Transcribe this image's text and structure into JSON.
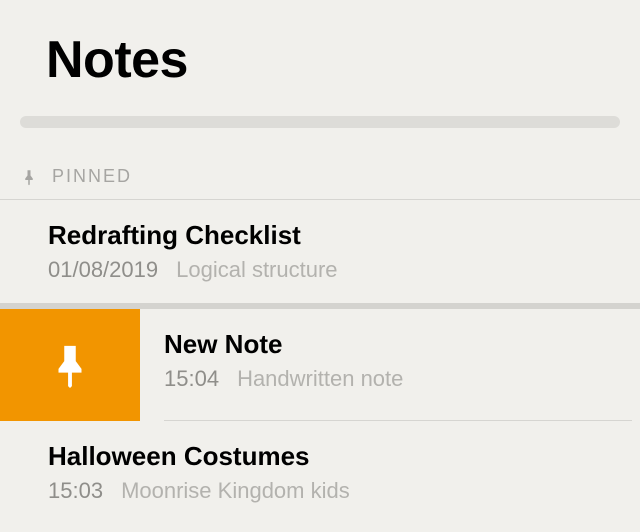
{
  "header": {
    "title": "Notes"
  },
  "pinned_section": {
    "label": "PINNED"
  },
  "pinned_notes": [
    {
      "title": "Redrafting Checklist",
      "date": "01/08/2019",
      "preview": "Logical structure"
    }
  ],
  "notes": [
    {
      "title": "New Note",
      "time": "15:04",
      "preview": "Handwritten note",
      "swiped": true
    },
    {
      "title": "Halloween Costumes",
      "time": "15:03",
      "preview": "Moonrise Kingdom kids",
      "swiped": false
    }
  ],
  "colors": {
    "swipe_pin": "#f29500"
  }
}
